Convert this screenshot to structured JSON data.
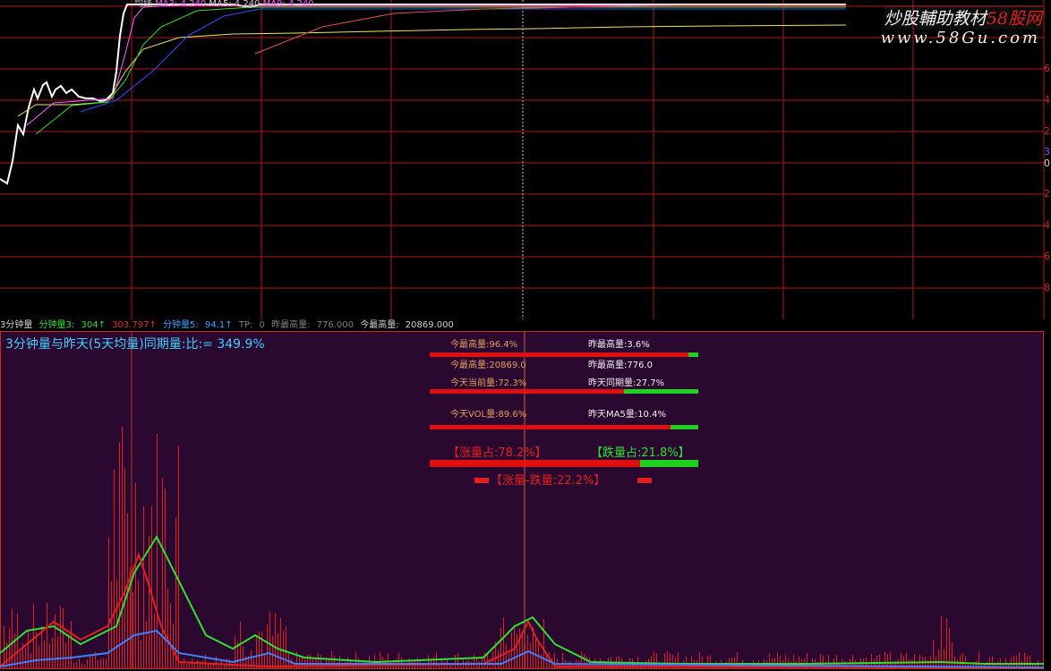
{
  "header": {
    "items": [
      {
        "text": "均线",
        "color": "#d0d0d0"
      },
      {
        "text": "MA3:",
        "color": "#ff60ff"
      },
      {
        "text": "4.240",
        "color": "#ff60ff"
      },
      {
        "text": "MA5:",
        "color": "#d0d0d0"
      },
      {
        "text": "4.240",
        "color": "#d0d0d0"
      },
      {
        "text": "MA9:",
        "color": "#ff60ff"
      },
      {
        "text": "4.240",
        "color": "#ff60ff"
      }
    ]
  },
  "watermark": {
    "brand_main": "炒股輔助教材",
    "brand_accent": "58股网",
    "url": "www.58Gu.com"
  },
  "top_chart": {
    "right_ticks": [
      "6",
      "4",
      "2",
      "3",
      "0",
      "2",
      "4",
      "6",
      "8"
    ]
  },
  "indicator_bar": {
    "items": [
      {
        "text": "3分钟量",
        "color": "#d0d0d0"
      },
      {
        "text": "分钟量3:",
        "color": "#30e030"
      },
      {
        "text": "304↑",
        "color": "#30e030"
      },
      {
        "text": "303.797↑",
        "color": "#e03030"
      },
      {
        "text": "分钟量5:",
        "color": "#40a0ff"
      },
      {
        "text": "94.1↑",
        "color": "#40a0ff"
      },
      {
        "text": "TP:",
        "color": "#808080"
      },
      {
        "text": "0",
        "color": "#808080"
      },
      {
        "text": "昨最高量:",
        "color": "#808080"
      },
      {
        "text": "776.000",
        "color": "#808080"
      },
      {
        "text": "今最高量:",
        "color": "#d0d0d0"
      },
      {
        "text": "20869.000",
        "color": "#d0d0d0"
      }
    ]
  },
  "lower_panel": {
    "title": "3分钟量与昨天(5天均量)同期量:比:= 349.9%"
  },
  "stats": {
    "row1_left": "今最高量:96.4%",
    "row1_right": "昨最高量:3.6%",
    "row1_ratio": 0.964,
    "row2_left": "今最高量:20869.0",
    "row2_right": "昨最高量:776.0",
    "row3_left": "今天当前量:72.3%",
    "row3_right": "昨天同期量:27.7%",
    "row3_ratio": 0.723,
    "row4_left": "今天VOL量:89.6%",
    "row4_right": "昨天MA5量:10.4%",
    "row4_ratio": 0.896,
    "rise_label": "【涨量占:78.2%】",
    "fall_label": "【跌量占:21.8%】",
    "rise_ratio": 0.782,
    "diff_label": "【涨量-跌量:22.2%】"
  },
  "colors": {
    "grid": "#b01818",
    "up_bar": "#e02020",
    "green_line": "#30e030",
    "blue_line": "#4080ff",
    "panel_bg": "#2a0830"
  }
}
